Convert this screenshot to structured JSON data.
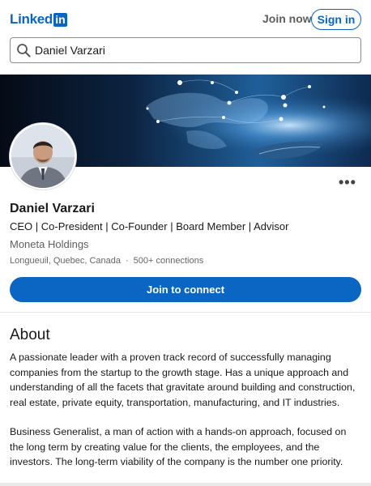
{
  "header": {
    "logo_text": "Linked",
    "logo_box": "in",
    "join_now": "Join now",
    "sign_in": "Sign in"
  },
  "search": {
    "value": "Daniel Varzari",
    "icon": "search-icon"
  },
  "profile": {
    "name": "Daniel Varzari",
    "headline": "CEO | Co-President | Co-Founder | Board Member | Advisor",
    "company": "Moneta Holdings",
    "location": "Longueuil, Quebec, Canada",
    "separator": "·",
    "connections": "500+ connections",
    "more": "•••",
    "connect_button": "Join to connect"
  },
  "about": {
    "title": "About",
    "paragraphs": [
      "A passionate leader with a proven track record of successfully managing companies from the startup to the growth stage. Has a unique approach and understanding of all the facets that gravitate around building and construction, real estate, private equity, transportation, manufacturing, and IT industries.",
      "Business Generalist, a man of action with a hands-on approach, focused on the long term by creating value for the clients, the employees, and the investors. The long-term viability of the company is the number one priority."
    ]
  },
  "colors": {
    "brand": "#0a66c2",
    "text": "#191919",
    "muted": "#5e5e5e"
  }
}
